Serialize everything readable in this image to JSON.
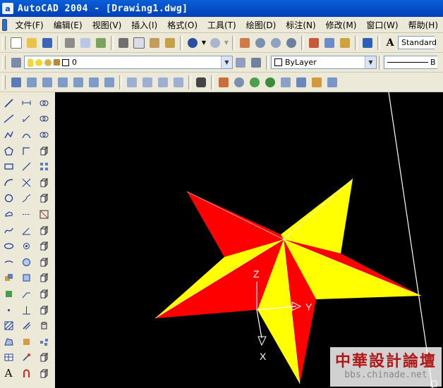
{
  "window": {
    "title": "AutoCAD 2004 - [Drawing1.dwg]",
    "app_icon_letter": "a"
  },
  "menu": [
    "文件(F)",
    "编辑(E)",
    "视图(V)",
    "插入(I)",
    "格式(O)",
    "工具(T)",
    "绘图(D)",
    "标注(N)",
    "修改(M)",
    "窗口(W)",
    "帮助(H)"
  ],
  "toolbar": {
    "text_style": "Standard",
    "layer": "0",
    "color": "ByLayer",
    "linetype": "ByLayer"
  },
  "ucs": {
    "x_label": "X",
    "y_label": "Y",
    "z_label": "Z"
  },
  "watermark": {
    "title": "中華設計論壇",
    "url": "bbs.chinade.net"
  },
  "colors": {
    "star_red": "#ff0000",
    "star_yellow": "#ffff00",
    "viewport_bg": "#000000"
  }
}
